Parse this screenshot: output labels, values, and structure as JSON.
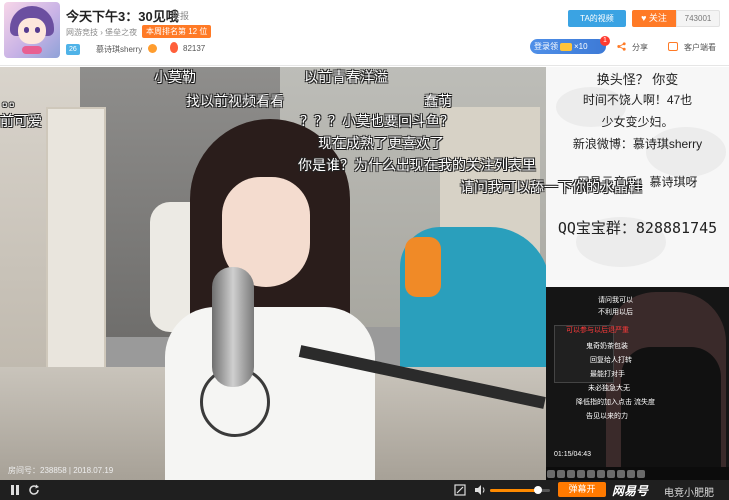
{
  "header": {
    "title": "今天下午3：30见哦",
    "report_label": "举报",
    "category": "网游竞技 › 堡垒之夜",
    "rank_label": "本周排名第  12  位",
    "level": "26",
    "anchor_name": "慕诗琪sherry",
    "hot_count": "82137",
    "his_video_label": "TA的视频",
    "follow_label": "关注",
    "follow_count": "743001",
    "login_label": "登录领",
    "login_count": "×10",
    "notif_count": "1",
    "share_label": "分享",
    "client_label": "客户端看"
  },
  "danmaku": [
    "小莫勒",
    "以前青春洋溢",
    "找以前视频看看",
    "蠢萌",
    "？？？小莫也要回斗鱼？",
    "现在成熟了更喜欢了",
    "你是谁？为什么出现在我的关注列表里",
    "请问我可以舔一下你的水晶鞋",
    "。。",
    "前可爱"
  ],
  "panel": {
    "line1": "换头怪？     你变",
    "line2": "时间不饶人啊！47也",
    "line3": "少女变少妇。",
    "weibo": "新浪微博：慕诗琪sherry",
    "music": "网易云音乐：慕诗琪呀",
    "qq": "QQ宝宝群：828881745"
  },
  "pip": {
    "lines": [
      "请问我可以",
      "不利用以后",
      "可以参与以后退严重",
      "鬼奇奶茶包装",
      "回复给人打转",
      "最能打对手",
      "未必独急大无",
      "降低指的加入点击 流失度",
      "告见以来的力"
    ],
    "time": "01:15/04:43"
  },
  "room_meta": "房间号：238858 | 2018.07.19",
  "controls": {
    "danmu_label": "弹幕开",
    "volume": 0.8,
    "watermark1": "网易号",
    "watermark2": "电竞小肥肥"
  },
  "colors": {
    "accent": "#ff7a26",
    "blue": "#3aa3e3"
  }
}
